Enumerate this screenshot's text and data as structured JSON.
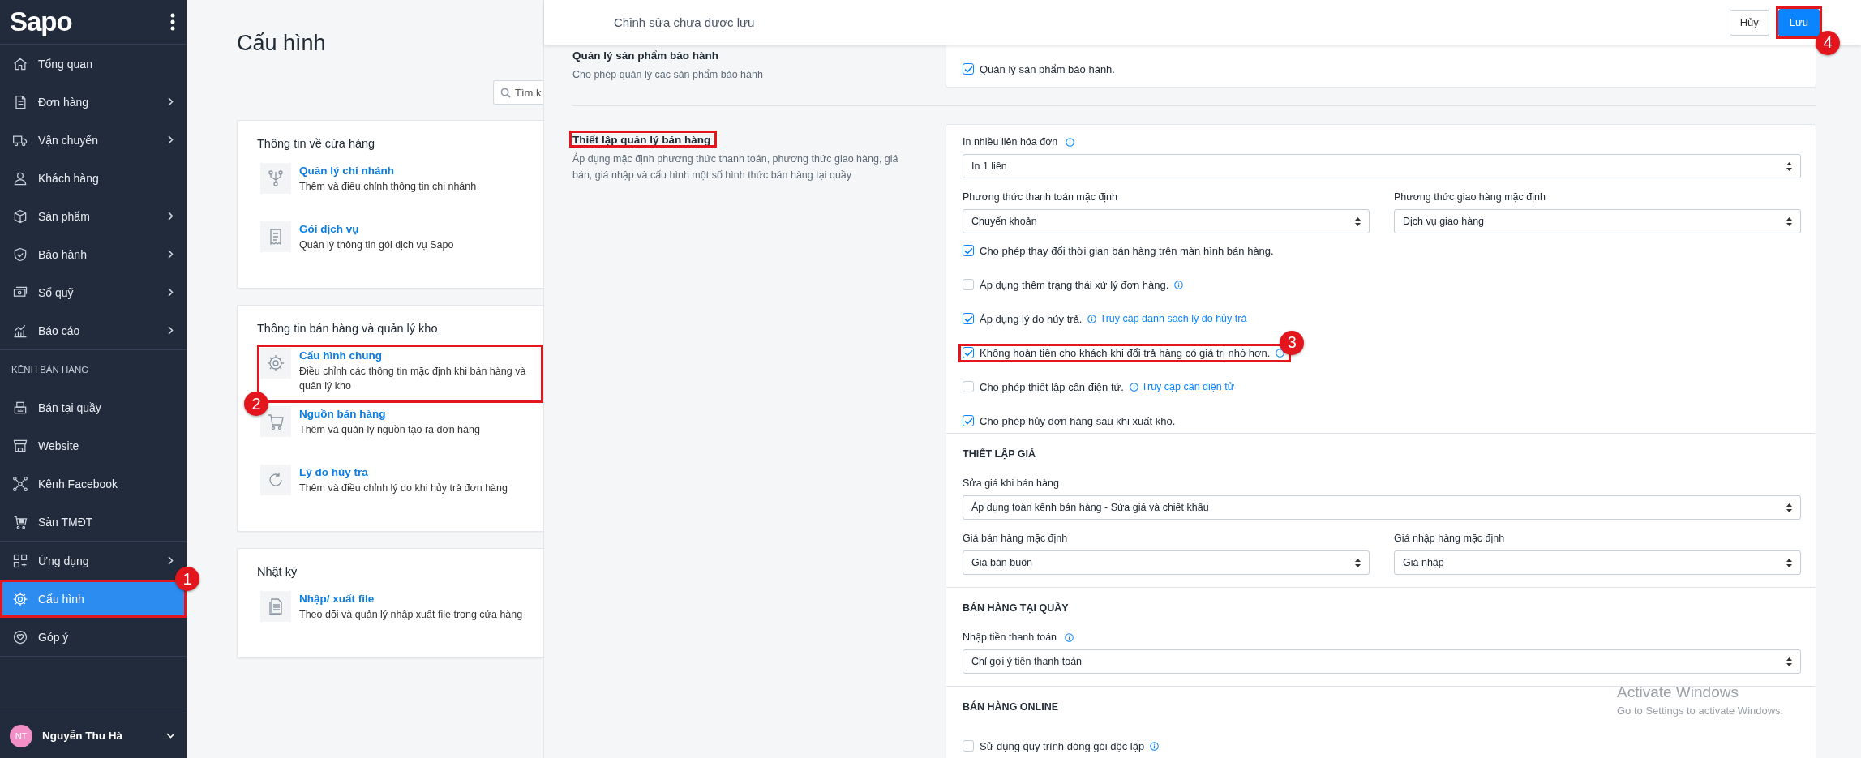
{
  "sidebar": {
    "logo": "Sapo",
    "groups": [
      {
        "items": [
          {
            "label": "Tổng quan",
            "submenu": false,
            "selected": false
          },
          {
            "label": "Đơn hàng",
            "submenu": true,
            "selected": false
          },
          {
            "label": "Vận chuyển",
            "submenu": true,
            "selected": false
          },
          {
            "label": "Khách hàng",
            "submenu": false,
            "selected": false
          },
          {
            "label": "Sản phẩm",
            "submenu": true,
            "selected": false
          },
          {
            "label": "Bảo hành",
            "submenu": true,
            "selected": false
          },
          {
            "label": "Sổ quỹ",
            "submenu": true,
            "selected": false
          },
          {
            "label": "Báo cáo",
            "submenu": true,
            "selected": false
          }
        ]
      },
      {
        "heading": "KÊNH BÁN HÀNG",
        "items": [
          {
            "label": "Bán tại quầy",
            "submenu": false,
            "selected": false
          },
          {
            "label": "Website",
            "submenu": false,
            "selected": false
          },
          {
            "label": "Kênh Facebook",
            "submenu": false,
            "selected": false
          },
          {
            "label": "Sàn TMĐT",
            "submenu": false,
            "selected": false
          }
        ]
      },
      {
        "items": [
          {
            "label": "Ứng dụng",
            "submenu": true,
            "selected": false
          },
          {
            "label": "Cấu hình",
            "submenu": false,
            "selected": true,
            "highlighted": true,
            "callout": "1"
          },
          {
            "label": "Góp ý",
            "submenu": false,
            "selected": false
          }
        ]
      }
    ],
    "user": {
      "initials": "NT",
      "name": "Nguyễn Thu Hà"
    }
  },
  "settings_page": {
    "title": "Cấu hình",
    "search": {
      "placeholder": "Tìm k"
    },
    "groups": [
      {
        "title": "Thông tin về cửa hàng",
        "items": [
          {
            "title": "Quản lý chi nhánh",
            "description": "Thêm và điều chỉnh thông tin chi nhánh"
          },
          {
            "title": "Gói dịch vụ",
            "description": "Quản lý thông tin gói dịch vụ Sapo"
          }
        ]
      },
      {
        "title": "Thông tin bán hàng và quản lý kho",
        "items": [
          {
            "title": "Cấu hình chung",
            "description": "Điều chỉnh các thông tin mặc định khi bán hàng và quản lý kho",
            "highlighted": true,
            "callout": "2"
          },
          {
            "title": "Nguồn bán hàng",
            "description": "Thêm và quản lý nguồn tạo ra đơn hàng"
          },
          {
            "title": "Lý do hủy trả",
            "description": "Thêm và điều chỉnh lý do khi hủy trả đơn hàng"
          }
        ]
      },
      {
        "title": "Nhật ký",
        "items": [
          {
            "title": "Nhập/ xuất file",
            "description": "Theo dõi và quản lý nhập xuất file trong cửa hàng"
          }
        ]
      }
    ]
  },
  "editor": {
    "message": "Chỉnh sửa chưa được lưu",
    "cancel": "Hủy",
    "save": {
      "label": "Lưu",
      "highlighted": true,
      "callout": "4"
    },
    "sections": [
      {
        "title": "Quản lý sản phẩm bảo hành",
        "description": "Cho phép quản lý các sản phẩm bảo hành",
        "fields": [
          {
            "kind": "checkbox",
            "label": "Quản lý sản phẩm bảo hành.",
            "checked": true
          }
        ]
      },
      {
        "title": "Thiết lập quản lý bán hàng",
        "highlighted": true,
        "description": "Áp dụng mặc định phương thức thanh toán, phương thức giao hàng, giá bán, giá nhập và cấu hình một số hình thức bán hàng tại quầy",
        "fields": [
          {
            "kind": "select",
            "label": "In nhiều liên hóa đơn",
            "info": true,
            "value": "In 1 liên"
          },
          {
            "kind": "pair",
            "fields": [
              {
                "label": "Phương thức thanh toán mặc định",
                "value": "Chuyển khoản"
              },
              {
                "label": "Phương thức giao hàng mặc định",
                "value": "Dịch vụ giao hàng"
              }
            ]
          },
          {
            "kind": "checkbox",
            "label": "Cho phép thay đổi thời gian bán hàng trên màn hình bán hàng.",
            "checked": true
          },
          {
            "kind": "checkbox",
            "label": "Áp dụng thêm trạng thái xử lý đơn hàng.",
            "checked": false,
            "info": true
          },
          {
            "kind": "checkbox",
            "label": "Áp dụng lý do hủy trả.",
            "checked": true,
            "info": true,
            "link": "Truy cập danh sách lý do hủy trả"
          },
          {
            "kind": "checkbox",
            "label": "Không hoàn tiền cho khách khi đổi trả hàng có giá trị nhỏ hơn.",
            "checked": true,
            "info": true,
            "highlighted": true,
            "callout": "3"
          },
          {
            "kind": "checkbox",
            "label": "Cho phép thiết lập cân điện tử.",
            "checked": false,
            "info": true,
            "link": "Truy cập cân điện tử"
          },
          {
            "kind": "checkbox",
            "label": "Cho phép hủy đơn hàng sau khi xuất kho.",
            "checked": true
          },
          {
            "kind": "heading",
            "text": "THIẾT LẬP GIÁ"
          },
          {
            "kind": "select",
            "label": "Sửa giá khi bán hàng",
            "value": "Áp dụng toàn kênh bán hàng - Sửa giá và chiết khấu"
          },
          {
            "kind": "pair",
            "fields": [
              {
                "label": "Giá bán hàng mặc định",
                "value": "Giá bán buôn"
              },
              {
                "label": "Giá nhập hàng mặc định",
                "value": "Giá nhập"
              }
            ]
          },
          {
            "kind": "heading",
            "text": "BÁN HÀNG TẠI QUẦY"
          },
          {
            "kind": "select",
            "label": "Nhập tiền thanh toán",
            "info": true,
            "value": "Chỉ gợi ý tiền thanh toán"
          },
          {
            "kind": "heading",
            "text": "BÁN HÀNG ONLINE"
          },
          {
            "kind": "checkbox",
            "label": "Sử dụng quy trình đóng gói độc lập",
            "checked": false,
            "info": true
          }
        ]
      }
    ]
  },
  "activation_notice": {
    "title": "Activate Windows",
    "text": "Go to Settings to activate Windows."
  }
}
